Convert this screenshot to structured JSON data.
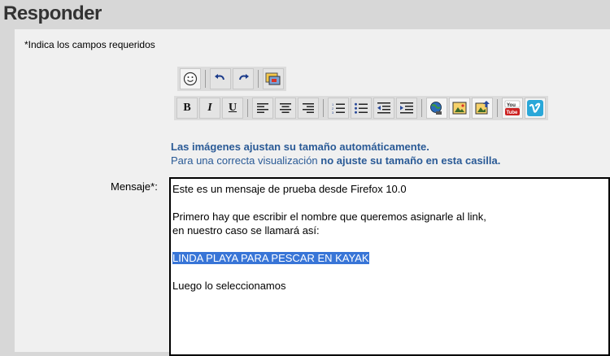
{
  "page": {
    "title": "Responder"
  },
  "form": {
    "required_note": "*Indica los campos requeridos",
    "info_line1": "Las imágenes ajustan su tamaño automáticamente.",
    "info_line2_normal": "Para una correcta visualización ",
    "info_line2_bold": "no ajuste su tamaño en esta casilla.",
    "message_label": "Mensaje*:"
  },
  "toolbar": {
    "row1": [
      {
        "name": "smiley-icon",
        "glyph": "☺"
      },
      {
        "name": "undo-icon",
        "glyph": "↶"
      },
      {
        "name": "redo-icon",
        "glyph": "↷"
      },
      {
        "name": "insert-media-icon",
        "glyph": "▣"
      }
    ],
    "row2": {
      "bold": "B",
      "italic": "I",
      "underline": "U"
    }
  },
  "editor": {
    "line1": "Este es un mensaje de prueba desde Firefox 10.0",
    "line2": "Primero hay que escribir el nombre que queremos asignarle al link,",
    "line3": "en nuestro caso se llamará así:",
    "selected_text": "LINDA PLAYA PARA PESCAR EN KAYAK",
    "line5": "Luego lo seleccionamos"
  },
  "colors": {
    "info_text": "#2a5a96",
    "selection": "#3875d7",
    "youtube_red": "#cc2222",
    "vimeo_blue": "#2aa7d8"
  }
}
